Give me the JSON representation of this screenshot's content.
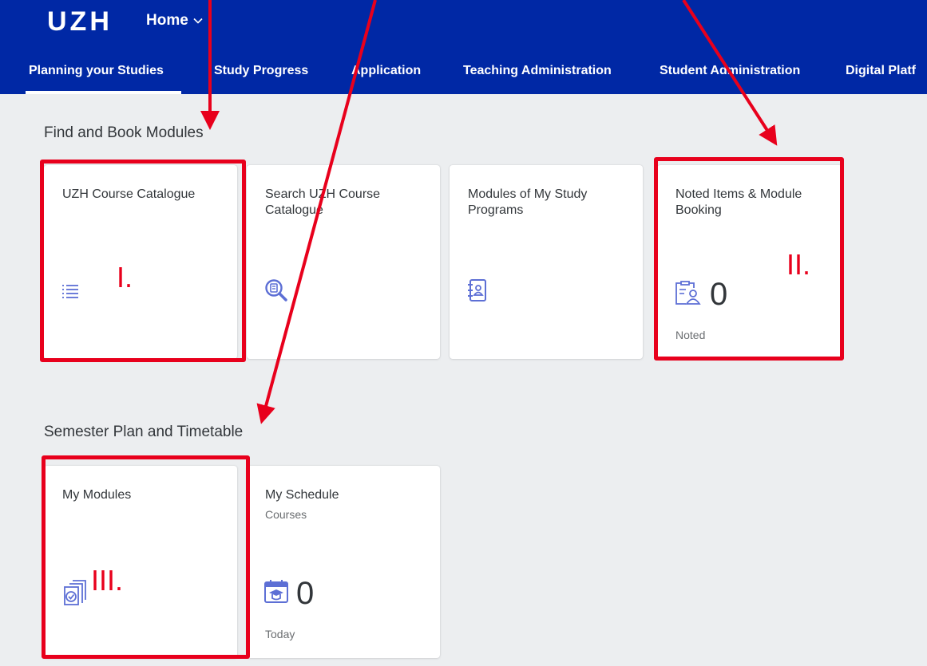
{
  "shell": {
    "logo": "UZH",
    "home_label": "Home"
  },
  "tabs": [
    {
      "label": "Planning your Studies",
      "active": true
    },
    {
      "label": "Study Progress"
    },
    {
      "label": "Application"
    },
    {
      "label": "Teaching Administration"
    },
    {
      "label": "Student Administration"
    },
    {
      "label": "Digital Platf"
    }
  ],
  "sections": [
    {
      "title": "Find and Book Modules",
      "tiles": [
        {
          "title": "UZH Course Catalogue",
          "icon": "list-icon"
        },
        {
          "title": "Search UZH Course Catalogue",
          "icon": "search-document-icon"
        },
        {
          "title": "Modules of My Study Programs",
          "icon": "address-book-icon"
        },
        {
          "title": "Noted Items & Module Booking",
          "icon": "clipboard-person-icon",
          "number": "0",
          "footer": "Noted"
        }
      ]
    },
    {
      "title": "Semester Plan and Timetable",
      "tiles": [
        {
          "title": "My Modules",
          "icon": "stacked-documents-check-icon"
        },
        {
          "title": "My Schedule",
          "subtitle": "Courses",
          "icon": "calendar-graduation-icon",
          "number": "0",
          "footer": "Today"
        }
      ]
    }
  ],
  "annotations": {
    "label_1": "I.",
    "label_2": "II.",
    "label_3": "III.",
    "color": "#e8001c"
  },
  "colors": {
    "shell": "#0028a5",
    "background": "#eceef0",
    "icon": "#5d6fd5"
  }
}
